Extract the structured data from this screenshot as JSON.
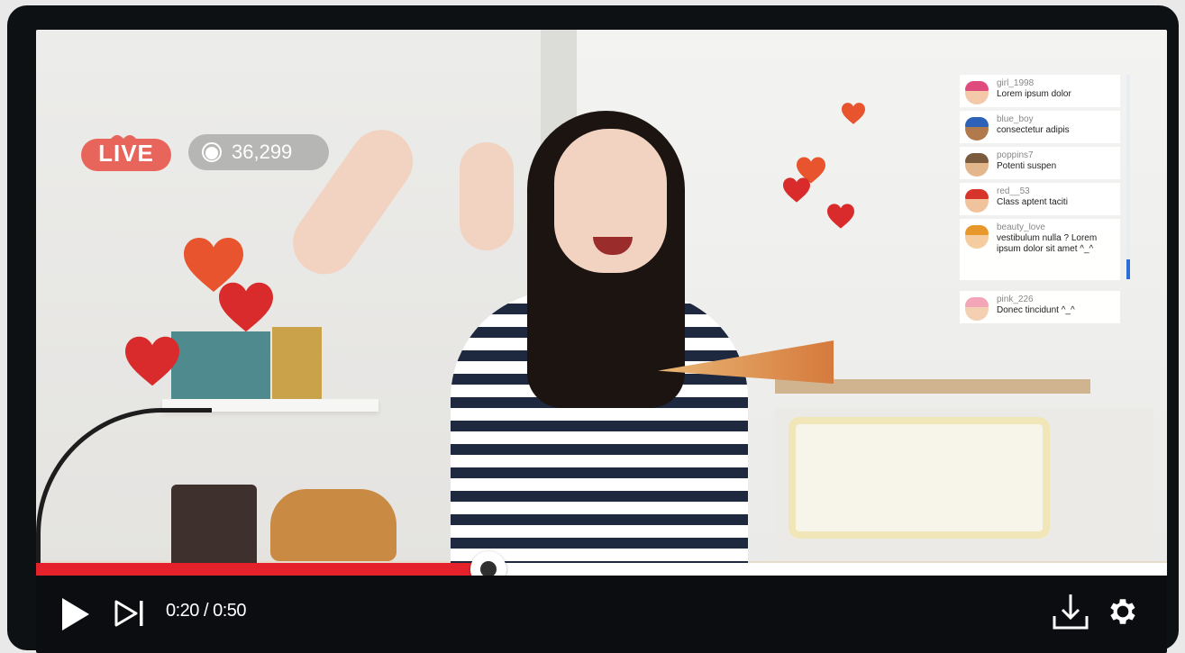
{
  "live_badge": {
    "label": "LIVE"
  },
  "viewers": {
    "count": "36,299"
  },
  "chat": {
    "messages": [
      {
        "user": "girl_1998",
        "text": "Lorem ipsum dolor",
        "hat_color": "#e04b7d",
        "skin": "#f3c9a9"
      },
      {
        "user": "blue_boy",
        "text": "consectetur adipis",
        "hat_color": "#2d62b8",
        "skin": "#b07a4c"
      },
      {
        "user": "poppins7",
        "text": "Potenti suspen",
        "hat_color": "#7a5b3d",
        "skin": "#e3b68c"
      },
      {
        "user": "red__53",
        "text": "Class aptent taciti",
        "hat_color": "#d7342c",
        "skin": "#f1c39c"
      },
      {
        "user": "beauty_love",
        "text": "vestibulum nulla ? Lorem ipsum dolor sit amet ^_^",
        "hat_color": "#e8982a",
        "skin": "#f5cc9f"
      },
      {
        "user": "pink_226",
        "text": "Donec tincidunt ^_^",
        "hat_color": "#f2a6b8",
        "skin": "#f4cfb2"
      }
    ]
  },
  "player": {
    "current_time": "0:20",
    "duration": "0:50",
    "time_display": "0:20 / 0:50",
    "progress_fraction": 0.4,
    "accent_color": "#e5222b"
  },
  "icons": {
    "play": "play-icon",
    "next": "skip-next-icon",
    "download": "download-icon",
    "settings": "gear-icon",
    "viewers": "viewer-eye-icon",
    "hearts": "heart-icon"
  }
}
